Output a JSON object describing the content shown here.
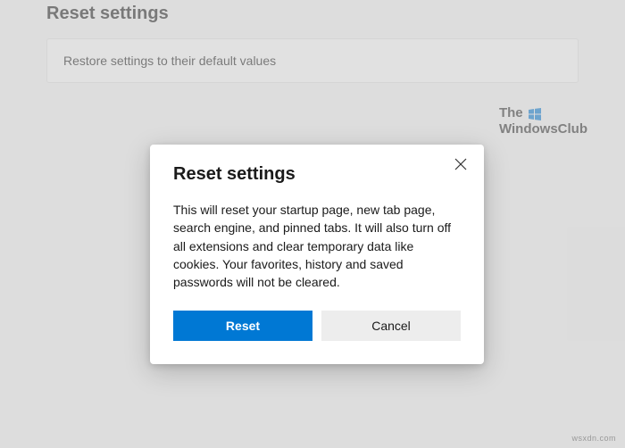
{
  "page": {
    "title": "Reset settings",
    "row_label": "Restore settings to their default values"
  },
  "branding": {
    "line1": "The",
    "line2": "WindowsClub"
  },
  "dialog": {
    "title": "Reset settings",
    "body": "This will reset your startup page, new tab page, search engine, and pinned tabs. It will also turn off all extensions and clear temporary data like cookies. Your favorites, history and saved passwords will not be cleared.",
    "reset_label": "Reset",
    "cancel_label": "Cancel"
  },
  "watermark": "wsxdn.com"
}
